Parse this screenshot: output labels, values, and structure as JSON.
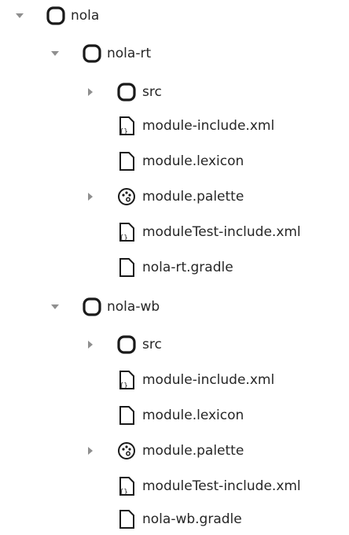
{
  "tree": {
    "root": {
      "label": "nola",
      "icon": "folder-icon",
      "expanded": true
    },
    "modules": [
      {
        "label": "nola-rt",
        "icon": "folder-icon",
        "expanded": true,
        "children": [
          {
            "label": "src",
            "icon": "folder-icon",
            "expandable": true
          },
          {
            "label": "module-include.xml",
            "icon": "xml-file-icon"
          },
          {
            "label": "module.lexicon",
            "icon": "file-icon"
          },
          {
            "label": "module.palette",
            "icon": "palette-icon",
            "expandable": true
          },
          {
            "label": "moduleTest-include.xml",
            "icon": "xml-file-icon"
          },
          {
            "label": "nola-rt.gradle",
            "icon": "file-icon"
          }
        ]
      },
      {
        "label": "nola-wb",
        "icon": "folder-icon",
        "expanded": true,
        "children": [
          {
            "label": "src",
            "icon": "folder-icon",
            "expandable": true
          },
          {
            "label": "module-include.xml",
            "icon": "xml-file-icon"
          },
          {
            "label": "module.lexicon",
            "icon": "file-icon"
          },
          {
            "label": "module.palette",
            "icon": "palette-icon",
            "expandable": true
          },
          {
            "label": "moduleTest-include.xml",
            "icon": "xml-file-icon"
          },
          {
            "label": "nola-wb.gradle",
            "icon": "file-icon"
          }
        ]
      }
    ]
  },
  "colors": {
    "twisty": "#8f8f8f",
    "icon_stroke": "#1a1a1a",
    "text": "#262626"
  }
}
